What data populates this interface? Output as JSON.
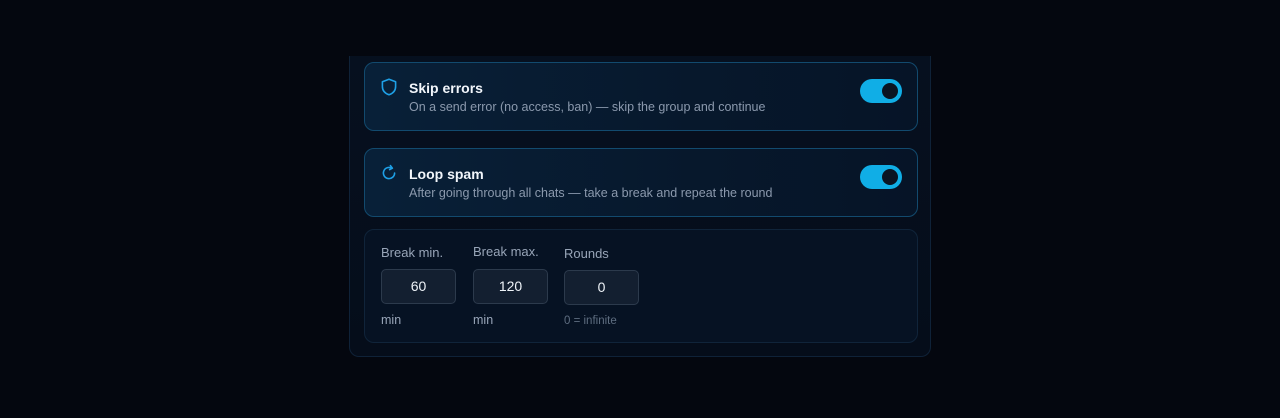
{
  "options": [
    {
      "title": "Skip errors",
      "description": "On a send error (no access, ban) — skip the group and continue",
      "enabled": true,
      "icon": "shield-icon"
    },
    {
      "title": "Loop spam",
      "description": "After going through all chats — take a break and repeat the round",
      "enabled": true,
      "icon": "refresh-icon"
    }
  ],
  "break_settings": {
    "break_min": {
      "label": "Break min.",
      "value": "60",
      "unit": "min"
    },
    "break_max": {
      "label": "Break max.",
      "value": "120",
      "unit": "min"
    },
    "rounds": {
      "label": "Rounds",
      "value": "0",
      "hint": "0 = infinite"
    }
  },
  "colors": {
    "accent": "#10aee6",
    "background": "#04070f",
    "card_border": "#124a6e"
  }
}
